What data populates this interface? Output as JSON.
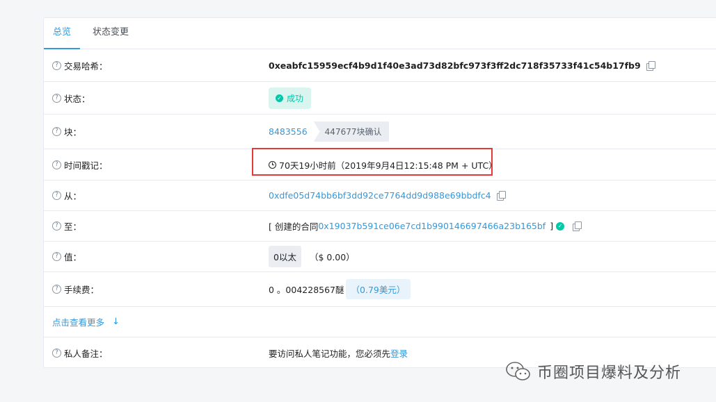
{
  "tabs": [
    {
      "label": "总览",
      "active": true
    },
    {
      "label": "状态变更",
      "active": false
    }
  ],
  "rows": {
    "tx_hash": {
      "label": "交易哈希：",
      "value": "0xeabfc15959ecf4b9d1f40e3ad73d82bfc973f3ff2dc718f35733f41c54b17fb9"
    },
    "status": {
      "label": "状态：",
      "value": "成功"
    },
    "block": {
      "label": "块：",
      "value": "8483556",
      "confirmations": "447677块确认"
    },
    "timestamp": {
      "label": "时间戳记：",
      "value": "70天19小时前（2019年9月4日12:15:48 PM + UTC）"
    },
    "from": {
      "label": "从：",
      "value": "0xdfe05d74bb6bf3dd92ce7764dd9d988e69bbdfc4"
    },
    "to": {
      "label": "至：",
      "prefix": "[ 创建的合同",
      "value": "0x19037b591ce06e7cd1b990146697466a23b165bf",
      "suffix": "]"
    },
    "value": {
      "label": "值：",
      "value": "0以太",
      "usd": "（$ 0.00）"
    },
    "fee": {
      "label": "手续费：",
      "value": "0 。004228567醚",
      "usd": "（0.79美元）"
    },
    "private_note": {
      "label": "私人备注：",
      "text": "要访问私人笔记功能，您必须先",
      "link": "登录"
    }
  },
  "more_link": "点击查看更多",
  "watermark": "币圈项目爆料及分析",
  "colors": {
    "accent": "#3498db",
    "success": "#00c9a7",
    "highlight": "#e53935"
  },
  "icons": {
    "help": "question-circle-icon",
    "copy": "copy-icon",
    "clock": "clock-icon",
    "check": "check-circle-icon",
    "arrow": "arrow-down-icon"
  }
}
